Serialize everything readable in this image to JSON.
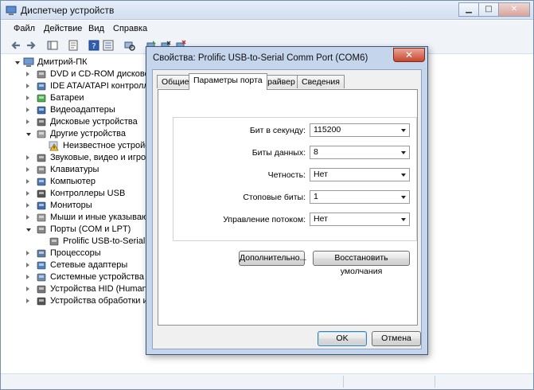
{
  "window": {
    "title": "Диспетчер устройств",
    "buttons": {
      "minimize": "▁",
      "maximize": "□",
      "close": "✕"
    }
  },
  "menu": [
    "Файл",
    "Действие",
    "Вид",
    "Справка"
  ],
  "toolbar_icons": [
    "back-arrow-icon",
    "forward-arrow-icon",
    "console-tree-icon",
    "properties-icon",
    "help-icon",
    "view-icon",
    "scan-hardware-icon",
    "update-driver-icon",
    "disable-device-icon",
    "uninstall-device-icon"
  ],
  "tree": {
    "root": "Дмитрий-ПК",
    "items": [
      {
        "label": "DVD и CD-ROM дисководы",
        "icon": "dvd-icon",
        "level": 1,
        "expander": "collapsed"
      },
      {
        "label": "IDE ATA/ATAPI контроллеры",
        "icon": "ide-controller-icon",
        "level": 1,
        "expander": "collapsed"
      },
      {
        "label": "Батареи",
        "icon": "battery-icon",
        "level": 1,
        "expander": "collapsed"
      },
      {
        "label": "Видеоадаптеры",
        "icon": "display-adapter-icon",
        "level": 1,
        "expander": "collapsed"
      },
      {
        "label": "Дисковые устройства",
        "icon": "disk-drive-icon",
        "level": 1,
        "expander": "collapsed"
      },
      {
        "label": "Другие устройства",
        "icon": "other-devices-icon",
        "level": 1,
        "expander": "expanded"
      },
      {
        "label": "Неизвестное устройство",
        "icon": "unknown-device-warning-icon",
        "level": 2,
        "expander": "none"
      },
      {
        "label": "Звуковые, видео и игровые устройства",
        "icon": "sound-icon",
        "level": 1,
        "expander": "collapsed"
      },
      {
        "label": "Клавиатуры",
        "icon": "keyboard-icon",
        "level": 1,
        "expander": "collapsed"
      },
      {
        "label": "Компьютер",
        "icon": "computer-icon",
        "level": 1,
        "expander": "collapsed"
      },
      {
        "label": "Контроллеры USB",
        "icon": "usb-icon",
        "level": 1,
        "expander": "collapsed"
      },
      {
        "label": "Мониторы",
        "icon": "monitor-icon",
        "level": 1,
        "expander": "collapsed"
      },
      {
        "label": "Мыши и иные указывающие устройства",
        "icon": "mouse-icon",
        "level": 1,
        "expander": "collapsed"
      },
      {
        "label": "Порты (COM и LPT)",
        "icon": "port-icon",
        "level": 1,
        "expander": "expanded"
      },
      {
        "label": "Prolific USB-to-Serial Comm Port (COM6)",
        "icon": "serial-port-icon",
        "level": 2,
        "expander": "none"
      },
      {
        "label": "Процессоры",
        "icon": "processor-icon",
        "level": 1,
        "expander": "collapsed"
      },
      {
        "label": "Сетевые адаптеры",
        "icon": "network-adapter-icon",
        "level": 1,
        "expander": "collapsed"
      },
      {
        "label": "Системные устройства",
        "icon": "system-devices-icon",
        "level": 1,
        "expander": "collapsed"
      },
      {
        "label": "Устройства HID (Human Interface Devices)",
        "icon": "hid-icon",
        "level": 1,
        "expander": "collapsed"
      },
      {
        "label": "Устройства обработки изображений",
        "icon": "imaging-icon",
        "level": 1,
        "expander": "collapsed"
      }
    ]
  },
  "dialog": {
    "title": "Свойства: Prolific USB-to-Serial Comm Port (COM6)",
    "close": "✕",
    "tabs": [
      "Общие",
      "Параметры порта",
      "Драйвер",
      "Сведения"
    ],
    "active_tab": "Параметры порта",
    "fields": [
      {
        "label": "Бит в секунду:",
        "value": "115200"
      },
      {
        "label": "Биты данных:",
        "value": "8"
      },
      {
        "label": "Четность:",
        "value": "Нет"
      },
      {
        "label": "Стоповые биты:",
        "value": "1"
      },
      {
        "label": "Управление потоком:",
        "value": "Нет"
      }
    ],
    "advanced_button": "Дополнительно...",
    "restore_button": "Восстановить умолчания",
    "ok_button": "OK",
    "cancel_button": "Отмена"
  }
}
